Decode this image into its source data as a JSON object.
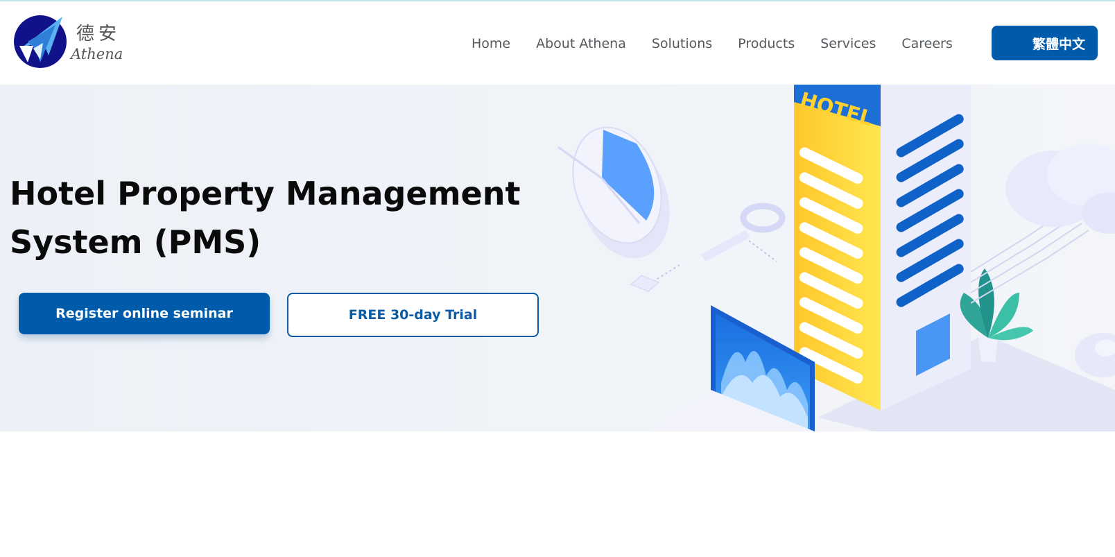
{
  "brand": {
    "name_cn": "德安",
    "name_en": "Athena"
  },
  "nav": {
    "items": [
      {
        "label": "Home"
      },
      {
        "label": "About Athena"
      },
      {
        "label": "Solutions"
      },
      {
        "label": "Products"
      },
      {
        "label": "Services"
      },
      {
        "label": "Careers"
      }
    ],
    "language_button": "繁體中文"
  },
  "hero": {
    "title_line1": "Hotel Property Management",
    "title_line2": "System (PMS)",
    "primary_button": "Register online seminar",
    "secondary_button": "FREE 30-day Trial",
    "illustration_sign": "HOTEL"
  },
  "colors": {
    "primary": "#005baa",
    "hero_bg": "#edf1f7",
    "hotel_yellow": "#ffd12e"
  }
}
